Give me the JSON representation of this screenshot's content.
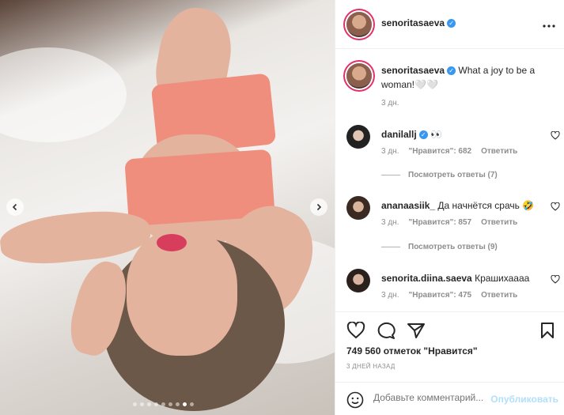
{
  "post": {
    "author": "senoritasaeva",
    "verified_mark": "✓",
    "more_icon": "more-horizontal-icon"
  },
  "carousel": {
    "prev_icon": "chevron-left-icon",
    "next_icon": "chevron-right-icon",
    "dot_count": 9,
    "active_dot": 7
  },
  "caption": {
    "author": "senoritasaeva",
    "text": "What a joy to be a woman!🤍🤍",
    "time": "3 дн."
  },
  "comments": [
    {
      "author": "danilallj",
      "verified": true,
      "text": "👀",
      "time": "3 дн.",
      "likes": "\"Нравится\": 682",
      "reply_label": "Ответить",
      "view_replies": "Посмотреть ответы (7)"
    },
    {
      "author": "ananaasiik_",
      "verified": false,
      "text": "Да начнётся срачь 🤣",
      "time": "3 дн.",
      "likes": "\"Нравится\": 857",
      "reply_label": "Ответить",
      "view_replies": "Посмотреть ответы (9)"
    },
    {
      "author": "senorita.diina.saeva",
      "verified": false,
      "text": "Крашихаааа",
      "time": "3 дн.",
      "likes": "\"Нравится\": 475",
      "reply_label": "Ответить",
      "view_replies": ""
    }
  ],
  "actions": {
    "like_icon": "heart-icon",
    "comment_icon": "comment-icon",
    "share_icon": "share-icon",
    "save_icon": "bookmark-icon"
  },
  "likes_summary": "749 560 отметок \"Нравится\"",
  "posted_ago": "3 ДНЕЙ НАЗАД",
  "add_comment": {
    "placeholder": "Добавьте комментарий...",
    "publish_label": "Опубликовать"
  },
  "colors": {
    "verified": "#3897f0",
    "publish_disabled": "#b2dffc",
    "muted": "#8e8e8e"
  }
}
